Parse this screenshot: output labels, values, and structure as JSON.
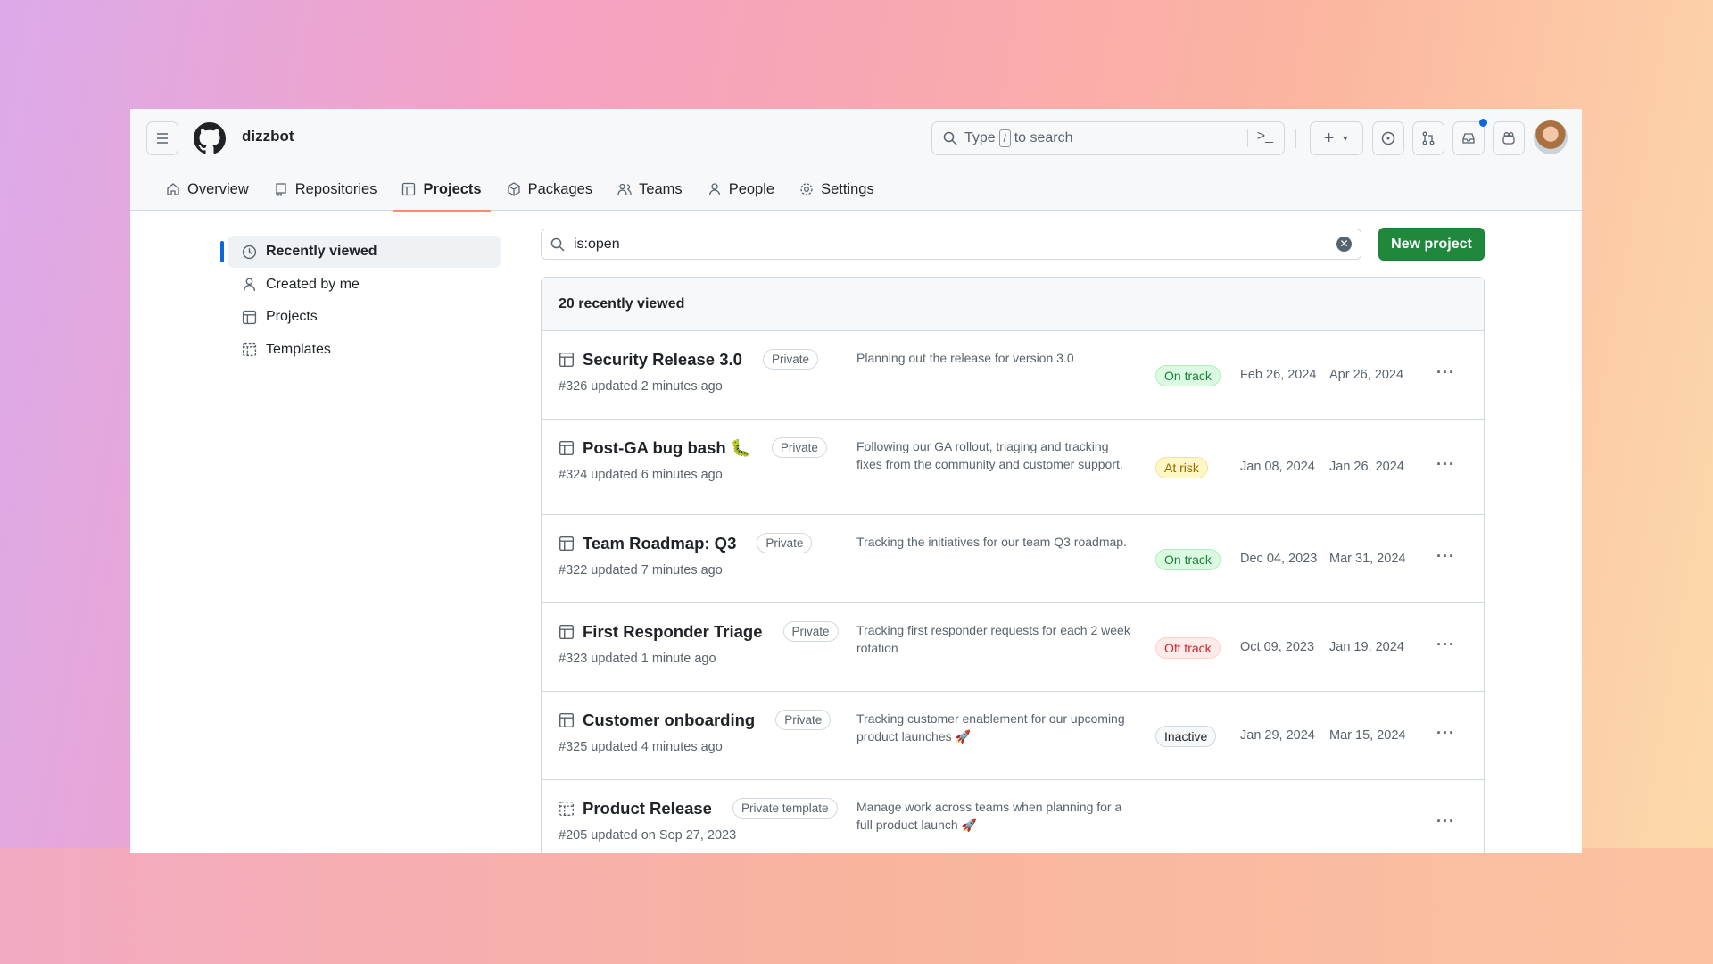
{
  "header": {
    "org": "dizzbot",
    "search_placeholder_pre": "Type",
    "search_key": "/",
    "search_placeholder_post": "to search"
  },
  "tabs": [
    {
      "label": "Overview",
      "icon": "home-icon"
    },
    {
      "label": "Repositories",
      "icon": "repo-icon"
    },
    {
      "label": "Projects",
      "icon": "table-icon",
      "selected": true
    },
    {
      "label": "Packages",
      "icon": "package-icon"
    },
    {
      "label": "Teams",
      "icon": "people-icon"
    },
    {
      "label": "People",
      "icon": "person-icon"
    },
    {
      "label": "Settings",
      "icon": "gear-icon"
    }
  ],
  "sidebar": {
    "items": [
      {
        "label": "Recently viewed",
        "icon": "clock-icon",
        "selected": true
      },
      {
        "label": "Created by me",
        "icon": "person-icon"
      },
      {
        "label": "Projects",
        "icon": "table-icon"
      },
      {
        "label": "Templates",
        "icon": "template-icon"
      }
    ]
  },
  "filter": {
    "value": "is:open"
  },
  "new_project": "New project",
  "list": {
    "heading": "20 recently viewed",
    "rows": [
      {
        "title": "Security Release 3.0",
        "badge": "Private",
        "meta": "#326 updated 2 minutes ago",
        "desc": "Planning out the release for version 3.0",
        "status": "On track",
        "start": "Feb 26, 2024",
        "end": "Apr 26, 2024",
        "icon": "table-icon"
      },
      {
        "title": "Post-GA bug bash 🐛",
        "badge": "Private",
        "meta": "#324 updated 6 minutes ago",
        "desc": "Following our GA rollout, triaging and tracking fixes from the community and customer support.",
        "status": "At risk",
        "start": "Jan 08, 2024",
        "end": "Jan 26, 2024",
        "icon": "table-icon"
      },
      {
        "title": "Team Roadmap: Q3",
        "badge": "Private",
        "meta": "#322 updated 7 minutes ago",
        "desc": "Tracking the initiatives for our team Q3 roadmap.",
        "status": "On track",
        "start": "Dec 04, 2023",
        "end": "Mar 31, 2024",
        "icon": "table-icon"
      },
      {
        "title": "First Responder Triage",
        "badge": "Private",
        "meta": "#323 updated 1 minute ago",
        "desc": "Tracking first responder requests for each 2 week rotation",
        "status": "Off track",
        "start": "Oct 09, 2023",
        "end": "Jan 19, 2024",
        "icon": "table-icon"
      },
      {
        "title": "Customer onboarding",
        "badge": "Private",
        "meta": "#325 updated 4 minutes ago",
        "desc": "Tracking customer enablement for our upcoming product launches 🚀",
        "status": "Inactive",
        "start": "Jan 29, 2024",
        "end": "Mar 15, 2024",
        "icon": "table-icon"
      },
      {
        "title": "Product Release",
        "badge": "Private template",
        "meta": "#205 updated on Sep 27, 2023",
        "desc": "Manage work across teams when planning for a full product launch 🚀",
        "status": "",
        "start": "",
        "end": "",
        "icon": "template-icon"
      }
    ]
  },
  "status_colors": {
    "On track": [
      "#dafbe1",
      "#1a7f37",
      "#aceebb"
    ],
    "At risk": [
      "#fff8c5",
      "#9a6700",
      "#f5e0a0"
    ],
    "Off track": [
      "#ffebe9",
      "#d1242f",
      "#ffcecb"
    ],
    "Inactive": [
      "#f6f8fa",
      "#1f2328",
      "#d1d9e0"
    ]
  },
  "colors": {
    "accent": "#0969da",
    "primary_button": "#1f883d",
    "tab_underline": "#fd8c73"
  }
}
